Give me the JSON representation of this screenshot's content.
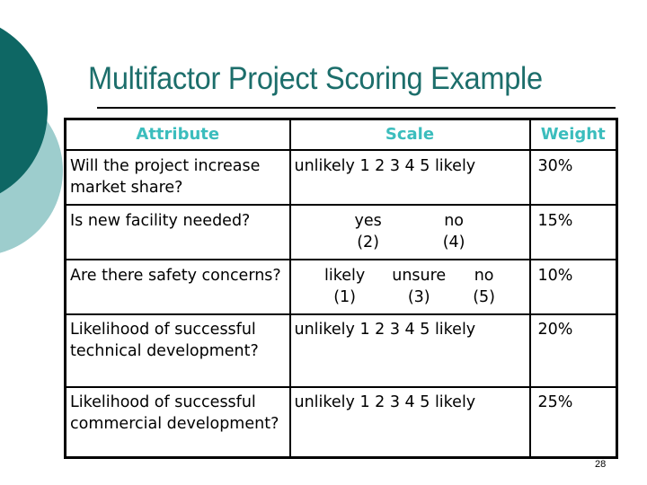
{
  "slide": {
    "title": "Multifactor Project Scoring Example",
    "page_number": "28",
    "colors": {
      "dark_teal": "#0e6764",
      "light_teal": "#9dcdcd",
      "title": "#1c6e6b",
      "header": "#3bbdbd"
    }
  },
  "table": {
    "headers": [
      "Attribute",
      "Scale",
      "Weight"
    ],
    "rows": [
      {
        "attribute": "Will the project increase market share?",
        "scale": "unlikely 1 2 3 4 5 likely",
        "weight": "30%"
      },
      {
        "attribute": "Is new facility needed?",
        "scale_options": [
          {
            "label": "yes",
            "value": "(2)"
          },
          {
            "label": "no",
            "value": "(4)"
          }
        ],
        "weight": "15%"
      },
      {
        "attribute": "Are there safety concerns?",
        "scale_options": [
          {
            "label": "likely",
            "value": "(1)"
          },
          {
            "label": "unsure",
            "value": "(3)"
          },
          {
            "label": "no",
            "value": "(5)"
          }
        ],
        "weight": "10%"
      },
      {
        "attribute": "Likelihood of successful technical development?",
        "scale": "unlikely 1 2 3 4 5 likely",
        "weight": "20%"
      },
      {
        "attribute": "Likelihood of successful commercial development?",
        "scale": "unlikely 1 2 3 4 5 likely",
        "weight": "25%"
      }
    ]
  }
}
